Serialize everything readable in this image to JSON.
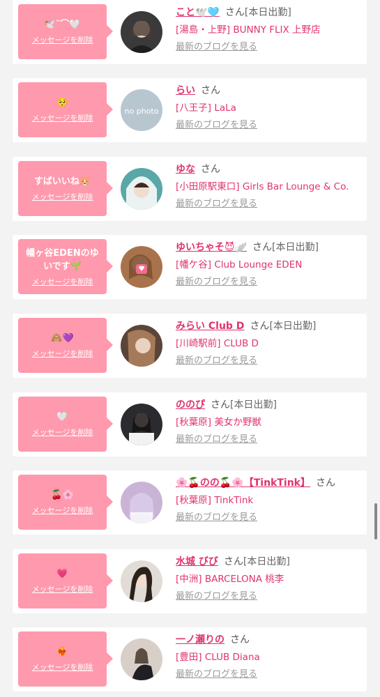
{
  "entries": [
    {
      "message": "🕊️˘⌒🤍",
      "delete_label": "メッセージを削除",
      "name": "こと🕊️🩵",
      "honorific": "さん",
      "status": "[本日出勤]",
      "shop": "[湯島・上野] BUNNY FLIX 上野店",
      "blog_label": "最新のブログを見る",
      "avatar_color": "#3a3a3a",
      "photo_text": ""
    },
    {
      "message": "🥺",
      "delete_label": "メッセージを削除",
      "name": "らい",
      "honorific": "さん",
      "status": "",
      "shop": "[八王子] LaLa",
      "blog_label": "最新のブログを見る",
      "avatar_color": "#b8c6d0",
      "photo_text": "no photo"
    },
    {
      "message": "すばいいね🐹",
      "delete_label": "メッセージを削除",
      "name": "ゆな",
      "honorific": "さん",
      "status": "",
      "shop": "[小田原駅東口] Girls Bar Lounge & Co.",
      "blog_label": "最新のブログを見る",
      "avatar_color": "#5aa7a8",
      "photo_text": ""
    },
    {
      "message": "幡ヶ谷EDENのゆいです🌱",
      "delete_label": "メッセージを削除",
      "name": "ゆいちゃそ😈🪽",
      "honorific": "さん",
      "status": "[本日出勤]",
      "shop": "[幡ケ谷] Club Lounge EDEN",
      "blog_label": "最新のブログを見る",
      "avatar_color": "#a8734c",
      "photo_text": ""
    },
    {
      "message": "🙈💜",
      "delete_label": "メッセージを削除",
      "name": "みらい Club D",
      "honorific": "さん",
      "status": "[本日出勤]",
      "shop": "[川崎駅前] CLUB D",
      "blog_label": "最新のブログを見る",
      "avatar_color": "#5b4438",
      "photo_text": ""
    },
    {
      "message": "🤍",
      "delete_label": "メッセージを削除",
      "name": "ののぴ",
      "honorific": "さん",
      "status": "[本日出勤]",
      "shop": "[秋葉原] 美女か野獣",
      "blog_label": "最新のブログを見る",
      "avatar_color": "#2b2b2f",
      "photo_text": ""
    },
    {
      "message": "🍒🌸",
      "delete_label": "メッセージを削除",
      "name": "🌸🍒のの🍒🌸【TinkTink】",
      "honorific": "さん",
      "status": "",
      "shop": "[秋葉原] TinkTink",
      "blog_label": "最新のブログを見る",
      "avatar_color": "#c9b3d6",
      "photo_text": ""
    },
    {
      "message": "💗",
      "delete_label": "メッセージを削除",
      "name": "水城 びび",
      "honorific": "さん",
      "status": "[本日出勤]",
      "shop": "[中洲] BARCELONA 桃李",
      "blog_label": "最新のブログを見る",
      "avatar_color": "#e2dcd7",
      "photo_text": ""
    },
    {
      "message": "❤️‍🔥",
      "delete_label": "メッセージを削除",
      "name": "一ノ瀬りの",
      "honorific": "さん",
      "status": "",
      "shop": "[豊田] CLUB Diana",
      "blog_label": "最新のブログを見る",
      "avatar_color": "#d7cfc8",
      "photo_text": ""
    }
  ]
}
